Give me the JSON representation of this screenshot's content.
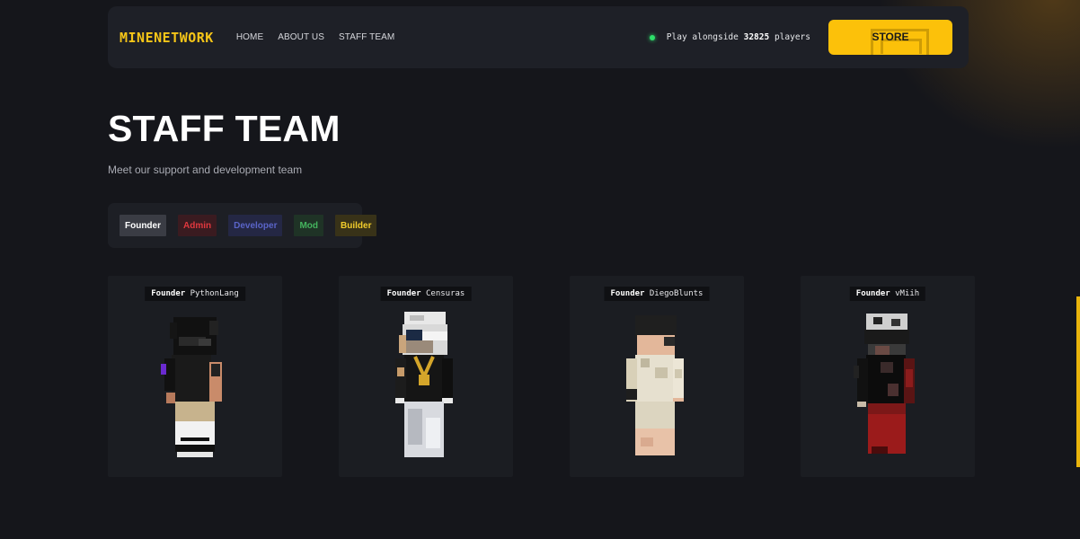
{
  "nav": {
    "logo": "MINENETWORK",
    "links": [
      "HOME",
      "ABOUT US",
      "STAFF TEAM"
    ],
    "players_prefix": "Play alongside",
    "players_count": "32825",
    "players_suffix": "players",
    "store_label": "STORE"
  },
  "header": {
    "title": "STAFF TEAM",
    "subtitle": "Meet our support and development team"
  },
  "filters": [
    "Founder",
    "Admin",
    "Developer",
    "Mod",
    "Builder"
  ],
  "staff": [
    {
      "role": "Founder",
      "name": "PythonLang"
    },
    {
      "role": "Founder",
      "name": "Censuras"
    },
    {
      "role": "Founder",
      "name": "DiegoBlunts"
    },
    {
      "role": "Founder",
      "name": "vMiih"
    }
  ],
  "colors": {
    "accent": "#fcc10a",
    "online": "#2ee06a",
    "admin": "#e0383e",
    "developer": "#5a64c8",
    "mod": "#44b45e",
    "builder": "#f1cc2b"
  }
}
